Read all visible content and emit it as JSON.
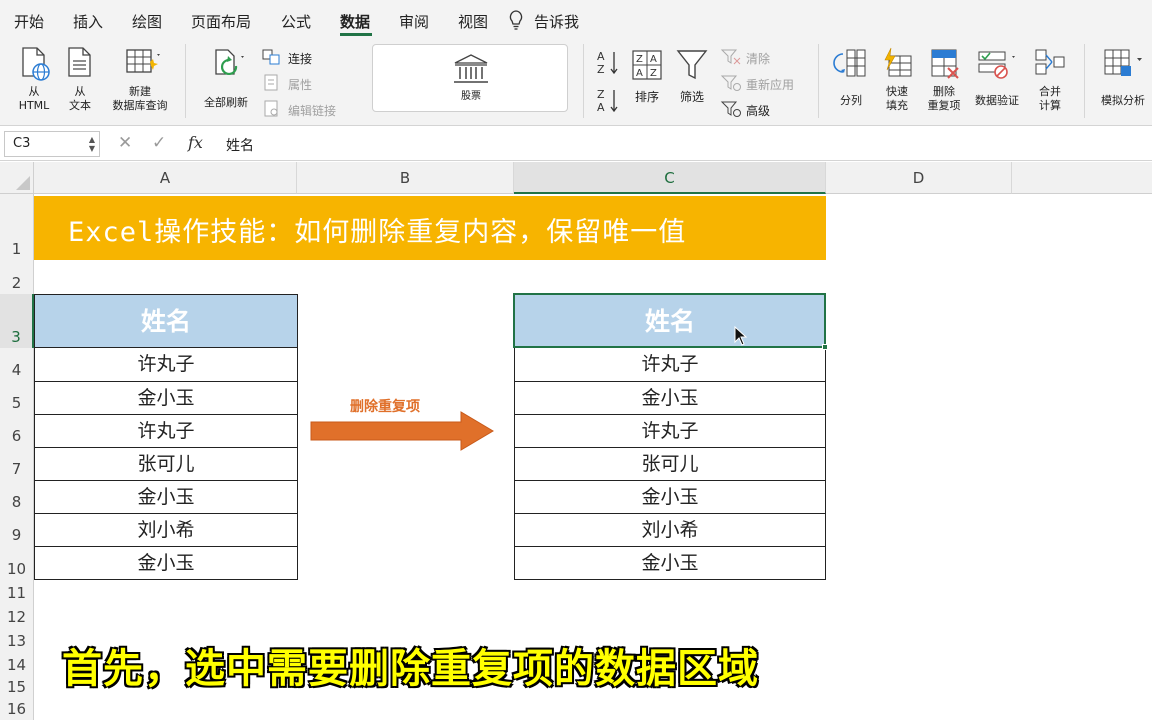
{
  "ribbon_tabs": [
    "开始",
    "插入",
    "绘图",
    "页面布局",
    "公式",
    "数据",
    "审阅",
    "视图",
    "告诉我"
  ],
  "active_tab": "数据",
  "ribbon": {
    "from_html": [
      "从",
      "HTML"
    ],
    "from_text": [
      "从",
      "文本"
    ],
    "new_db_query": [
      "新建",
      "数据库查询"
    ],
    "refresh_all": "全部刷新",
    "connections": "连接",
    "properties": "属性",
    "edit_links": "编辑链接",
    "stocks": "股票",
    "sort": "排序",
    "filter": "筛选",
    "clear": "清除",
    "reapply": "重新应用",
    "advanced": "高级",
    "split_columns": "分列",
    "flash_fill": [
      "快速",
      "填充"
    ],
    "remove_duplicates": [
      "删除",
      "重复项"
    ],
    "data_validation": "数据验证",
    "consolidate": [
      "合并",
      "计算"
    ],
    "what_if": "模拟分析"
  },
  "formula_bar": {
    "name_box": "C3",
    "content": "姓名"
  },
  "columns": [
    "A",
    "B",
    "C",
    "D"
  ],
  "rows": [
    "1",
    "2",
    "3",
    "4",
    "5",
    "6",
    "7",
    "8",
    "9",
    "10",
    "11",
    "12",
    "13",
    "14",
    "15",
    "16"
  ],
  "banner_title": "Excel操作技能：如何删除重复内容，保留唯一值",
  "left_table": {
    "header": "姓名",
    "names": [
      "许丸子",
      "金小玉",
      "许丸子",
      "张可儿",
      "金小玉",
      "刘小希",
      "金小玉"
    ]
  },
  "right_table": {
    "header": "姓名",
    "names": [
      "许丸子",
      "金小玉",
      "许丸子",
      "张可儿",
      "金小玉",
      "刘小希",
      "金小玉"
    ]
  },
  "arrow_label": "删除重复项",
  "subtitle": "首先，选中需要删除重复项的数据区域",
  "colors": {
    "accent_green": "#217346",
    "banner": "#f7b400",
    "table_header": "#b7d3ea",
    "arrow": "#e0702a",
    "subtitle": "#ffff00"
  }
}
